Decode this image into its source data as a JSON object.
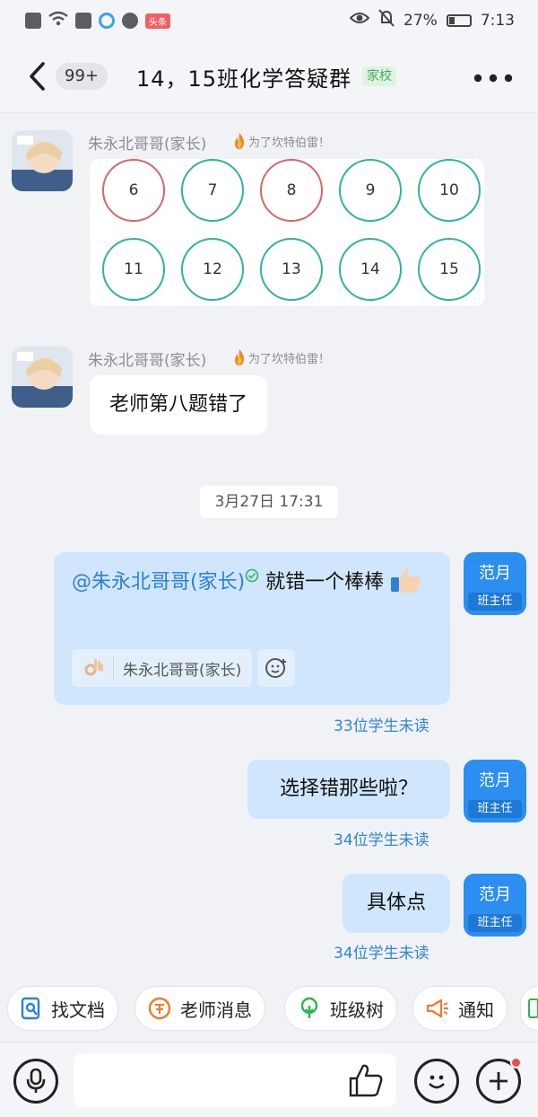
{
  "status_bar": {
    "battery": "27%",
    "time": "7:13",
    "news_badge": "头条",
    "battery_level": 0.27
  },
  "header": {
    "unread": "99+",
    "title": "14，15班化学答疑群",
    "tag": "家校"
  },
  "messages": [
    {
      "sender": "朱永北哥哥(家长)",
      "sender_tag": "为了坎特伯雷！",
      "numbers": [
        "6",
        "7",
        "8",
        "9",
        "10",
        "11",
        "12",
        "13",
        "14",
        "15"
      ],
      "wrong": [
        "6",
        "8"
      ]
    },
    {
      "sender": "朱永北哥哥(家长)",
      "sender_tag": "为了坎特伯雷！",
      "text": "老师第八题错了"
    }
  ],
  "timestamp": "3月27日 17:31",
  "teacher": {
    "name": "范月",
    "role": "班主任"
  },
  "replies": [
    {
      "mention": "@朱永北哥哥(家长)",
      "text": " 就错一个棒棒",
      "reaction_user": "朱永北哥哥(家长)",
      "read_status": "33位学生未读"
    },
    {
      "text": "选择错那些啦？",
      "read_status": "34位学生未读"
    },
    {
      "text": "具体点",
      "read_status": "34位学生未读"
    }
  ],
  "quick_tools": [
    "找文档",
    "老师消息",
    "班级树",
    "通知"
  ],
  "input": {
    "placeholder": ""
  }
}
